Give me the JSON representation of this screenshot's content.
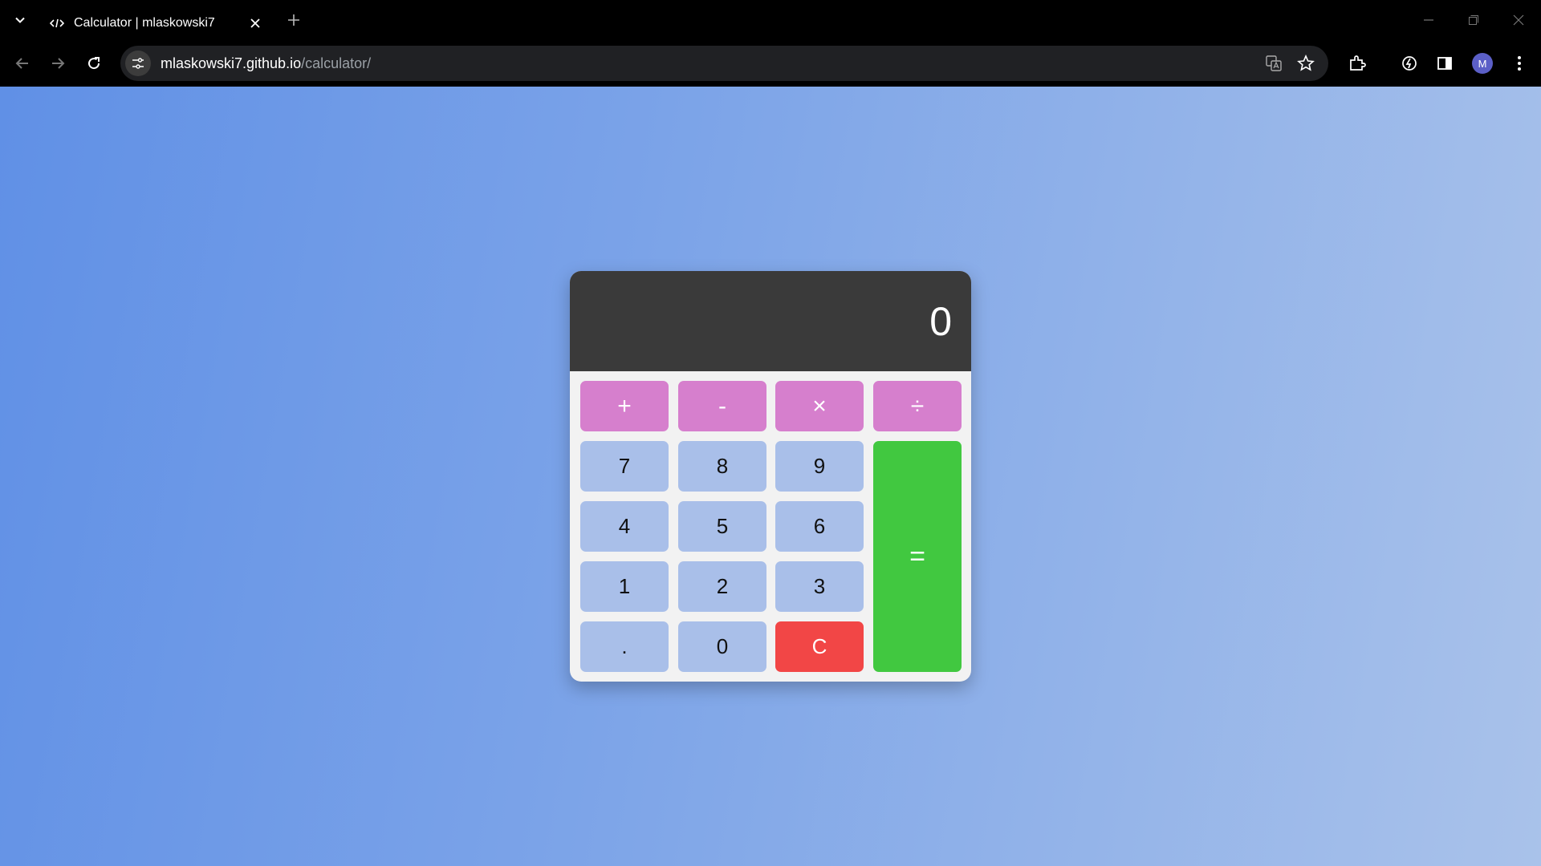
{
  "browser": {
    "tab_title": "Calculator | mlaskowski7",
    "url_host": "mlaskowski7.github.io",
    "url_path": "/calculator/",
    "profile_initial": "M"
  },
  "calculator": {
    "display_value": "0",
    "keys": {
      "add": "+",
      "subtract": "-",
      "multiply": "×",
      "divide": "÷",
      "seven": "7",
      "eight": "8",
      "nine": "9",
      "four": "4",
      "five": "5",
      "six": "6",
      "one": "1",
      "two": "2",
      "three": "3",
      "decimal": ".",
      "zero": "0",
      "clear": "C",
      "equals": "="
    }
  },
  "colors": {
    "operator": "#d67fcd",
    "number": "#a9bfe9",
    "clear": "#f24646",
    "equals": "#41c840",
    "display": "#3a3a3a"
  }
}
